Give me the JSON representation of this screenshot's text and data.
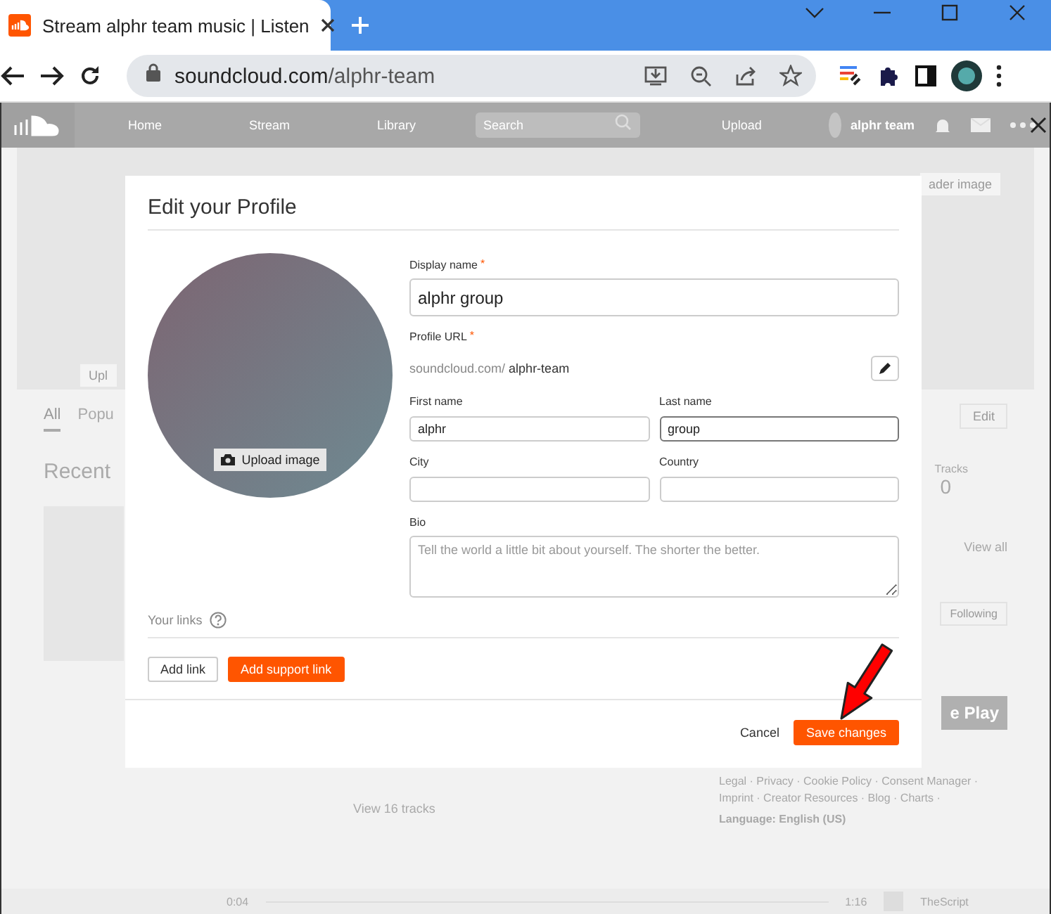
{
  "browser": {
    "tab_title": "Stream alphr team music | Listen",
    "url_domain": "soundcloud.com",
    "url_path": "/alphr-team"
  },
  "site_nav": {
    "items": [
      "Home",
      "Stream",
      "Library"
    ],
    "search_placeholder": "Search",
    "upload": "Upload",
    "user": "alphr team"
  },
  "profile_page": {
    "header_image_button": "ader image",
    "upload_button": "Upl",
    "tabs": [
      {
        "label": "All",
        "selected": true
      },
      {
        "label": "Popu",
        "selected": false
      }
    ],
    "edit_button": "Edit",
    "recent_heading": "Recent",
    "tracks_label": "Tracks",
    "tracks_count": "0",
    "view_all": "View all",
    "following_button": "Following",
    "store_badge": "e Play",
    "view_tracks": "View 16 tracks",
    "footer_links": [
      "Legal · Privacy · Cookie Policy · Consent Manager ·",
      "Imprint · Creator Resources · Blog · Charts ·"
    ],
    "language": "Language: English (US)"
  },
  "player": {
    "elapsed": "0:04",
    "duration": "1:16",
    "track": "TheScript"
  },
  "modal": {
    "title": "Edit your Profile",
    "upload_image": "Upload image",
    "display_name": {
      "label": "Display name",
      "required": true,
      "required_mark": "*",
      "value": "alphr group"
    },
    "profile_url": {
      "label": "Profile URL",
      "required": true,
      "required_mark": "*",
      "prefix": "soundcloud.com/",
      "slug": "alphr-team"
    },
    "first_name": {
      "label": "First name",
      "value": "alphr",
      "focused": false
    },
    "last_name": {
      "label": "Last name",
      "value": "group",
      "focused": true
    },
    "city": {
      "label": "City"
    },
    "country": {
      "label": "Country"
    },
    "bio": {
      "label": "Bio",
      "placeholder": "Tell the world a little bit about yourself. The shorter the better."
    },
    "links_label": "Your links",
    "add_link": "Add link",
    "add_support_link": "Add support link",
    "cancel": "Cancel",
    "save": "Save changes"
  }
}
